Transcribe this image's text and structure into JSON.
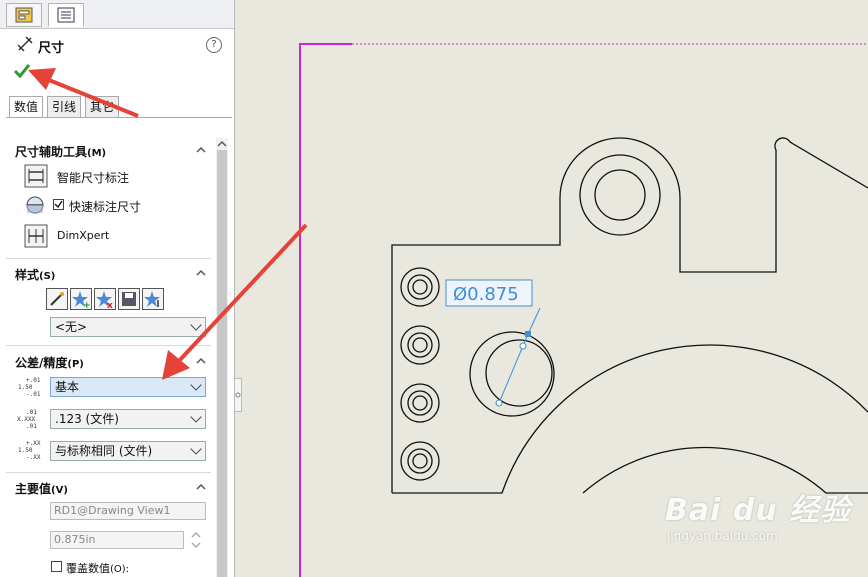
{
  "panel": {
    "title": "尺寸",
    "help": "?",
    "tabs": [
      "数值",
      "引线",
      "其它"
    ],
    "sections": {
      "tools": {
        "title": "尺寸辅助工具",
        "shortcut": "(M)",
        "smart_dimension": "智能尺寸标注",
        "quick_dimension": "快速标注尺寸",
        "dimxpert": "DimXpert"
      },
      "style": {
        "title": "样式",
        "shortcut": "(S)",
        "selected": "<无>"
      },
      "tolerance": {
        "title": "公差/精度",
        "shortcut": "(P)",
        "type": "基本",
        "precision": ".123 (文件)",
        "tolerance_precision": "与标称相同 (文件)",
        "icon1_top": "+.01",
        "icon1_mid": "1.50",
        "icon1_bot": "-.01",
        "icon2_top": ".01",
        "icon2_mid": "X.XXX",
        "icon2_bot": ".01",
        "icon3_top": "+.XX",
        "icon3_mid": "1.50",
        "icon3_bot": "-.XX"
      },
      "primary": {
        "title": "主要值",
        "shortcut": "(V)",
        "name": "RD1@Drawing View1",
        "value": "0.875in",
        "override": "覆盖数值",
        "override_shortcut": "(O):"
      }
    }
  },
  "drawing": {
    "dimension_text": "Ø0.875"
  },
  "watermark": {
    "main": "Bai du 经验",
    "sub": "jingyan.baidu.com"
  },
  "colors": {
    "arrow": "#e5423a",
    "dimension": "#3f8fd6",
    "sheet_border": "#d423d4",
    "confirm": "#2e9a2e"
  }
}
